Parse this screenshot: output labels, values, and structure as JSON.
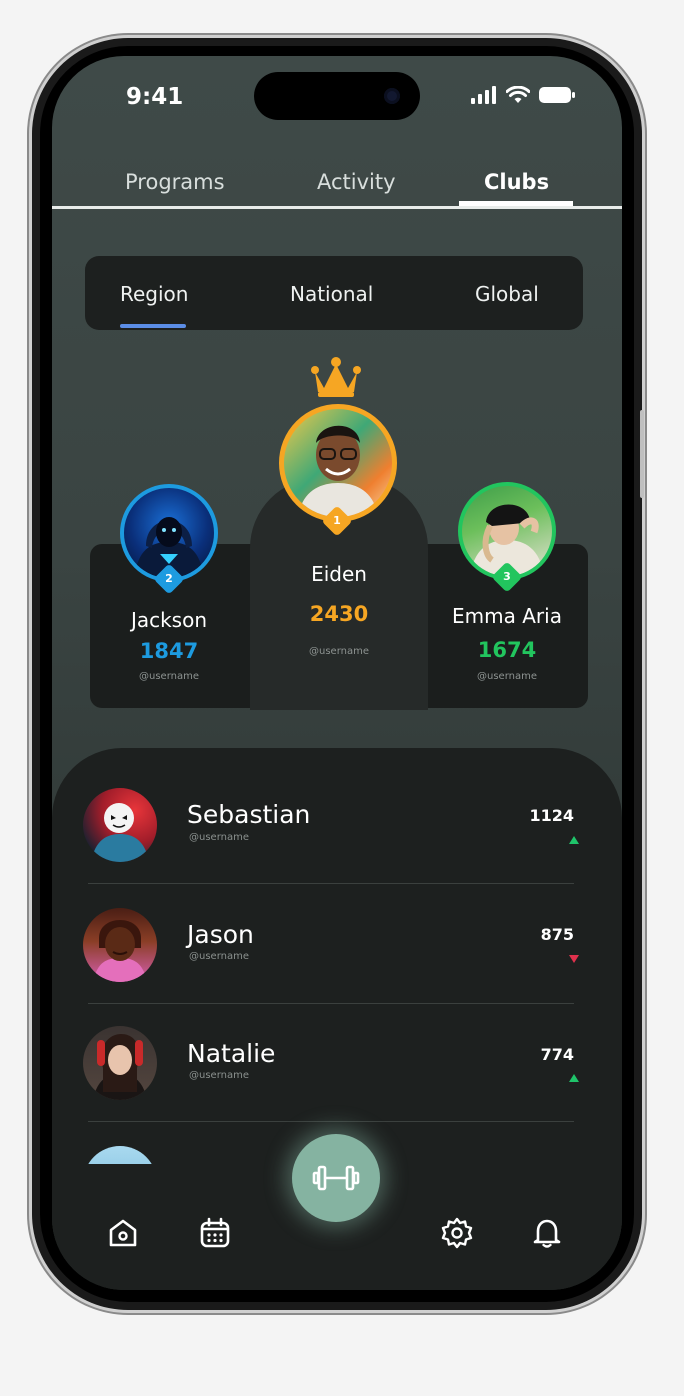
{
  "status_bar": {
    "time": "9:41",
    "icons": [
      "signal-icon",
      "wifi-icon",
      "battery-icon"
    ]
  },
  "top_tabs": [
    {
      "label": "Programs",
      "active": false
    },
    {
      "label": "Activity",
      "active": false
    },
    {
      "label": "Clubs",
      "active": true
    }
  ],
  "scope_tabs": [
    {
      "label": "Region",
      "active": true
    },
    {
      "label": "National",
      "active": false
    },
    {
      "label": "Global",
      "active": false
    }
  ],
  "podium": {
    "first": {
      "rank": "1",
      "name": "Eiden",
      "score": "2430",
      "username": "@username",
      "color": "#f6a623"
    },
    "second": {
      "rank": "2",
      "name": "Jackson",
      "score": "1847",
      "username": "@username",
      "color": "#1d9be0"
    },
    "third": {
      "rank": "3",
      "name": "Emma Aria",
      "score": "1674",
      "username": "@username",
      "color": "#22c55e"
    }
  },
  "leaderboard": [
    {
      "name": "Sebastian",
      "username": "@username",
      "score": "1124",
      "trend": "up"
    },
    {
      "name": "Jason",
      "username": "@username",
      "score": "875",
      "trend": "down"
    },
    {
      "name": "Natalie",
      "username": "@username",
      "score": "774",
      "trend": "up"
    }
  ],
  "colors": {
    "trend_up": "#1fc46a",
    "trend_down": "#e0314d",
    "fab": "#85b3a1",
    "accent": "#5b8de6"
  },
  "bottom_nav": [
    "home-icon",
    "calendar-icon",
    "dumbbell-icon",
    "settings-icon",
    "bell-icon"
  ]
}
